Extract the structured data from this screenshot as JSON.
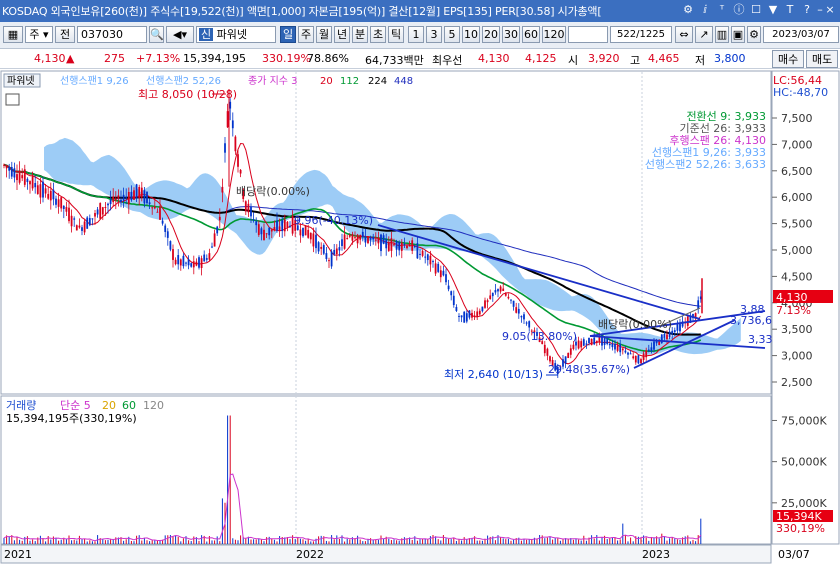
{
  "window": {
    "title": "KOSDAQ 외국인보유[260(천)] 주식수[19,522(천)] 액면[1,000] 자본금[195(억)] 결산[12월] EPS[135] PER[30.58] 시가총액[",
    "controls": [
      "⚙",
      "ⅈ",
      "ᵀ",
      "ⓘ",
      "☐",
      "▼",
      "T",
      "?",
      "–",
      "□",
      "×"
    ]
  },
  "toolbar": {
    "market": "주",
    "prev": "전",
    "code": "037030",
    "power_label": "파워넷",
    "period_tabs": [
      "일",
      "주",
      "월",
      "년",
      "분",
      "초",
      "틱"
    ],
    "intervals": [
      "1",
      "3",
      "5",
      "10",
      "20",
      "30",
      "60",
      "120"
    ],
    "count": "522",
    "total": "1225",
    "date": "2023/03/07",
    "buy": "매수",
    "sell": "매도"
  },
  "pricebar": {
    "price": "4,130",
    "arrow": "▲",
    "change": "275",
    "change_pct": "+7.13%",
    "volume": "15,394,195",
    "vol_ratio": "330.19%",
    "turnover": "78.86%",
    "amount": "64,733백만",
    "best_sell_label": "최우선",
    "best_sell": "4,130",
    "best_buy": "4,125",
    "open_label": "시",
    "open": "3,920",
    "high_label": "고",
    "high": "4,465",
    "low_label": "저",
    "low": "3,800"
  },
  "legend": {
    "top_tag": "파워넷",
    "span1": "선행스팬1 9,26",
    "span2": "선행스팬2 52,26",
    "ma_label": "종가 지수 3",
    "ma20": "20",
    "ma112": "112",
    "ma224": "224",
    "ma448": "448",
    "lc": "LC:56,44",
    "hc": "HC:-48,70"
  },
  "ichimoku_legend": [
    {
      "text": "전환선 9: 3,933",
      "color": "#009933"
    },
    {
      "text": "기준선 26: 3,933",
      "color": "#555555"
    },
    {
      "text": "후행스팬 26: 4,130",
      "color": "#cc33cc"
    },
    {
      "text": "선행스팬1 9,26: 3,933",
      "color": "#66aaff"
    },
    {
      "text": "선행스팬2 52,26: 3,633",
      "color": "#66aaff"
    }
  ],
  "annotations": {
    "high": "최고 8,050 (10/28)",
    "low": "최저 2,640 (10/13)",
    "div1": "배당락(0.00%)",
    "div2": "배당락(0.00%)",
    "pct1": "9.96(-40.13%)",
    "pct2": "9.05(13.80%)",
    "pct3": "29.48(35.67%)",
    "tl1": "3,88",
    "tl2": "3,736,6",
    "tl3": "3,33"
  },
  "price_axis": [
    "7,500",
    "7,000",
    "6,500",
    "6,000",
    "5,500",
    "5,000",
    "4,500",
    "4,000",
    "3,500",
    "3,000",
    "2,500"
  ],
  "price_tag": {
    "price": "4,130",
    "pct": "7.13%"
  },
  "volume_legend": {
    "label": "거래량",
    "simple": "단순 5",
    "ma20": "20",
    "ma60": "60",
    "ma120": "120",
    "value": "15,394,195주(330,19%)"
  },
  "volume_axis": [
    "75,000K",
    "50,000K",
    "25,000K"
  ],
  "volume_tag": {
    "value": "15,394K",
    "pct": "330,19%"
  },
  "time_axis": [
    "2021",
    "2022",
    "2023",
    "03/07"
  ],
  "colors": {
    "up": "#d9001b",
    "down": "#0033cc",
    "cloud": "#7fb8f0",
    "ma20": "#d9001b",
    "ma112": "#009933",
    "ma224": "#000000",
    "ma448": "#1f2dbd"
  }
}
